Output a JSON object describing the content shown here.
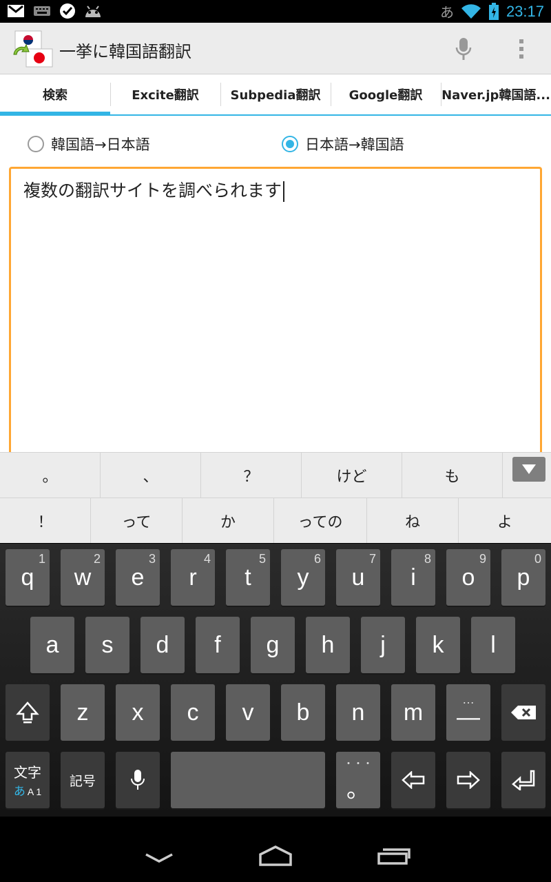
{
  "status_bar": {
    "ime_indicator": "あ",
    "time": "23:17",
    "icons": [
      "gmail-icon",
      "keyboard-icon",
      "check-icon",
      "android-icon",
      "wifi-icon",
      "battery-icon"
    ]
  },
  "action_bar": {
    "title": "一挙に韓国語翻訳",
    "mic_icon": "microphone-icon",
    "overflow_icon": "overflow-menu-icon"
  },
  "tabs": [
    {
      "label": "検索",
      "active": true
    },
    {
      "label": "Excite翻訳",
      "active": false
    },
    {
      "label": "Subpedia翻訳",
      "active": false
    },
    {
      "label": "Google翻訳",
      "active": false
    },
    {
      "label": "Naver.jp韓国語..."
    }
  ],
  "direction": {
    "options": [
      {
        "label": "韓国語→日本語",
        "checked": false
      },
      {
        "label": "日本語→韓国語",
        "checked": true
      }
    ]
  },
  "input": {
    "value": "複数の翻訳サイトを調べられます"
  },
  "candidates": {
    "row1": [
      "。",
      "、",
      "？",
      "けど",
      "も"
    ],
    "row2": [
      "！",
      "って",
      "か",
      "っての",
      "ね",
      "よ"
    ]
  },
  "keyboard": {
    "row1": [
      {
        "key": "q",
        "num": "1"
      },
      {
        "key": "w",
        "num": "2"
      },
      {
        "key": "e",
        "num": "3"
      },
      {
        "key": "r",
        "num": "4"
      },
      {
        "key": "t",
        "num": "5"
      },
      {
        "key": "y",
        "num": "6"
      },
      {
        "key": "u",
        "num": "7"
      },
      {
        "key": "i",
        "num": "8"
      },
      {
        "key": "o",
        "num": "9"
      },
      {
        "key": "p",
        "num": "0"
      }
    ],
    "row2": [
      "a",
      "s",
      "d",
      "f",
      "g",
      "h",
      "j",
      "k",
      "l"
    ],
    "row3": [
      "z",
      "x",
      "c",
      "v",
      "b",
      "n",
      "m"
    ],
    "dash_key": "—",
    "dash_dots": "…",
    "mode_key_top": "文字",
    "mode_key_bottom_a": "あ",
    "mode_key_bottom_b": "A 1",
    "symbol_key": "記号",
    "period_key": "。",
    "period_dots": "・・・"
  },
  "colors": {
    "accent": "#33b5e5",
    "input_border": "#ffa733",
    "key": "#5e5e5e",
    "key_dark": "#3a3a3a"
  }
}
